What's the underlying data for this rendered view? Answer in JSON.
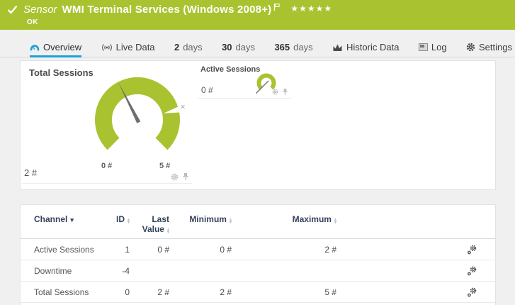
{
  "colors": {
    "green": "#a8c32f",
    "blue": "#1da2d8"
  },
  "header": {
    "kind": "Sensor",
    "title": "WMI Terminal Services (Windows 2008+)",
    "status": "OK",
    "stars": "★★★★★"
  },
  "tabs": {
    "overview": "Overview",
    "live_data": "Live Data",
    "d2_num": "2",
    "d2_unit": "days",
    "d30_num": "30",
    "d30_unit": "days",
    "d365_num": "365",
    "d365_unit": "days",
    "historic": "Historic Data",
    "log": "Log",
    "settings": "Settings"
  },
  "gauges": {
    "total": {
      "title": "Total Sessions",
      "value": "2 #",
      "scale_min": "0 #",
      "scale_max": "5 #"
    },
    "active": {
      "title": "Active Sessions",
      "value": "0 #"
    }
  },
  "chart_data": {
    "type": "gauge",
    "gauges": [
      {
        "title": "Total Sessions",
        "value": 2,
        "min": 0,
        "max": 5,
        "unit": "#"
      },
      {
        "title": "Active Sessions",
        "value": 0,
        "min": 0,
        "max": 2,
        "unit": "#"
      }
    ]
  },
  "table": {
    "headers": {
      "channel": "Channel",
      "id": "ID",
      "last1": "Last",
      "last2": "Value",
      "min": "Minimum",
      "max": "Maximum"
    },
    "rows": [
      {
        "channel": "Active Sessions",
        "id": "1",
        "last": "0 #",
        "min": "0 #",
        "max": "2 #"
      },
      {
        "channel": "Downtime",
        "id": "-4",
        "last": "",
        "min": "",
        "max": ""
      },
      {
        "channel": "Total Sessions",
        "id": "0",
        "last": "2 #",
        "min": "2 #",
        "max": "5 #"
      }
    ]
  }
}
